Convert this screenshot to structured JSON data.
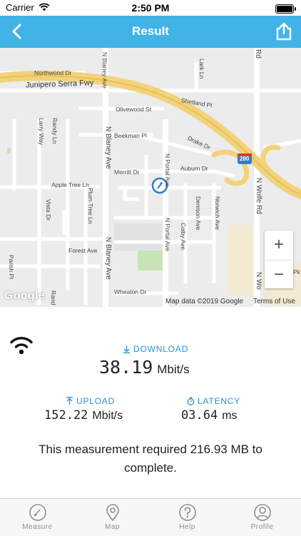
{
  "status_bar": {
    "carrier": "Carrier",
    "time": "2:50 PM"
  },
  "nav": {
    "title": "Result",
    "back_icon": "chevron-left-icon",
    "share_icon": "share-icon"
  },
  "map": {
    "labels": {
      "northwood": "Northwood Dr",
      "junipero": "Junipero Serra Fwy",
      "lark": "Lark Ln",
      "shetland": "Shetland Pl",
      "olivewood": "Olivewood St",
      "larry": "Larry Way",
      "randy": "Randy Ln",
      "beekman": "Beekman Pl",
      "drake": "Drake Dr",
      "merritt": "Merritt Dr",
      "auburn": "Auburn Dr",
      "apple_tree": "Apple Tree Ln",
      "vista": "Vista Dr",
      "plum_tree": "Plum Tree Ln",
      "denison": "Denison Ave",
      "norwich": "Norwich Ave",
      "colby": "Colby Ave",
      "forest": "Forest Ave",
      "parish": "Parish Pl",
      "wheaton": "Wheaton Dr",
      "n_blaney_top": "N Blaney Ave",
      "n_blaney": "N Blaney Ave",
      "n_portal_top": "N Portal Ave",
      "n_portal": "N Portal Ave",
      "n_wolfe": "N Wolfe Rd",
      "n_wo": "N Wo",
      "rd_top": "Rd",
      "rand": "Rand",
      "pk": "Pk",
      "shield": "280"
    },
    "zoom_in": "+",
    "zoom_out": "−",
    "google": "Google",
    "attribution": "Map data ©2019 Google",
    "terms": "Terms of Use"
  },
  "results": {
    "download": {
      "label": "DOWNLOAD",
      "value": "38.19",
      "unit": "Mbit/s"
    },
    "upload": {
      "label": "UPLOAD",
      "value": "152.22",
      "unit": "Mbit/s"
    },
    "latency": {
      "label": "LATENCY",
      "value": "03.64",
      "unit": "ms"
    },
    "summary": "This measurement required 216.93 MB to complete."
  },
  "tabs": [
    {
      "label": "Measure",
      "icon": "speedometer-icon"
    },
    {
      "label": "Map",
      "icon": "map-pin-icon"
    },
    {
      "label": "Help",
      "icon": "help-icon"
    },
    {
      "label": "Profile",
      "icon": "profile-icon"
    }
  ],
  "colors": {
    "accent": "#42b3e7",
    "link_blue": "#2d8fd1",
    "freeway": "#f2d27a"
  }
}
